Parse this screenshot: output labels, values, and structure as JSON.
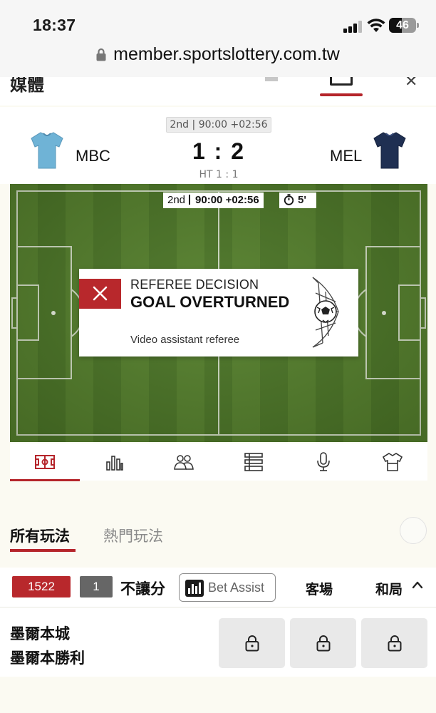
{
  "status_bar": {
    "time": "18:37",
    "battery_level": "46",
    "url": "member.sportslottery.com.tw",
    "icons": [
      "signal-icon",
      "wifi-icon",
      "battery-icon",
      "lock-icon"
    ]
  },
  "top_nav": {
    "partial_label": "媒體",
    "icons": [
      "list-icon",
      "scoreboard-icon",
      "close-icon"
    ]
  },
  "scoreboard": {
    "period": "2nd",
    "clock": "90:00 +02:56",
    "home_team": "MBC",
    "away_team": "MEL",
    "score": "1 : 2",
    "halftime": "HT 1 : 1",
    "home_color": "#6fb3d6",
    "away_color": "#1f2f52"
  },
  "pitch": {
    "period": "2nd",
    "clock": "90:00 +02:56",
    "added_time": "5'",
    "decision": {
      "kicker": "REFEREE DECISION",
      "headline": "GOAL OVERTURNED",
      "reason": "Video assistant referee"
    }
  },
  "match_tabs": [
    {
      "icon": "pitch-icon",
      "active": true
    },
    {
      "icon": "stats-bars-icon",
      "active": false
    },
    {
      "icon": "lineups-icon",
      "active": false
    },
    {
      "icon": "list-icon",
      "active": false
    },
    {
      "icon": "microphone-icon",
      "active": false
    },
    {
      "icon": "jersey-icon",
      "active": false
    }
  ],
  "bet_tabs": {
    "all": "所有玩法",
    "hot": "熱門玩法"
  },
  "market": {
    "code": "1522",
    "count": "1",
    "name": "不讓分",
    "bet_assist": "Bet Assist",
    "col_away": "客場",
    "col_draw": "和局"
  },
  "odds_row": {
    "line1": "墨爾本城",
    "line2": "墨爾本勝利",
    "locked": true
  },
  "colors": {
    "accent": "#b5252b",
    "pitch_light": "#55802c",
    "pitch_dark": "#4b7526"
  }
}
